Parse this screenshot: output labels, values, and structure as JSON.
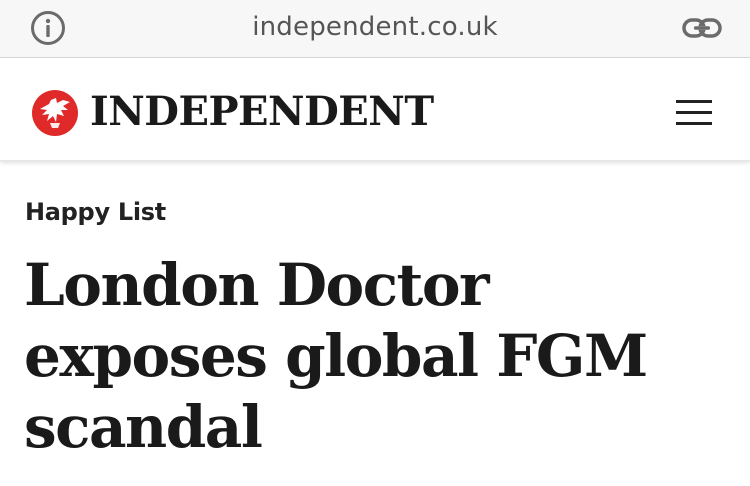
{
  "browser": {
    "url": "independent.co.uk",
    "info_icon": "info-icon",
    "share_icon": "link-icon"
  },
  "site": {
    "logo_text": "INDEPENDENT",
    "logo_icon": "eagle-logo-icon",
    "menu_icon": "hamburger-menu-icon"
  },
  "article": {
    "section": "Happy List",
    "headline": "London Doctor exposes global FGM scandal"
  },
  "colors": {
    "brand_red": "#e02a2a",
    "text": "#1a1a1a",
    "address_bar_bg": "#f7f7f7"
  }
}
